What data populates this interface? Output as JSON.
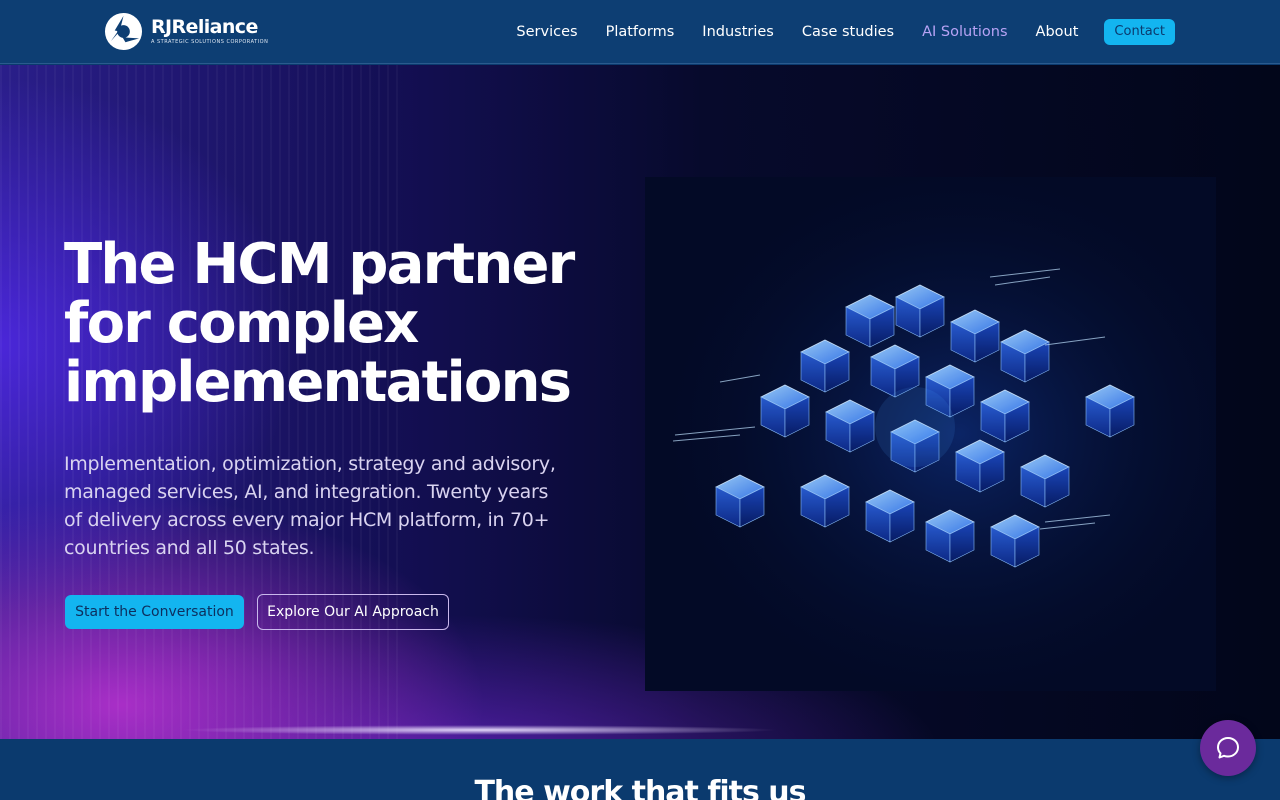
{
  "brand": {
    "name": "RJReliance",
    "tagline": "A STRATEGIC SOLUTIONS CORPORATION",
    "logo_icon": "rjreliance-logo-icon"
  },
  "nav": {
    "items": [
      {
        "label": "Services",
        "active": false
      },
      {
        "label": "Platforms",
        "active": false
      },
      {
        "label": "Industries",
        "active": false
      },
      {
        "label": "Case studies",
        "active": false
      },
      {
        "label": "AI Solutions",
        "active": true
      },
      {
        "label": "About",
        "active": false
      }
    ],
    "contact_label": "Contact"
  },
  "hero": {
    "title": "The HCM partner for complex implementations",
    "subtitle": "Implementation, optimization, strategy and advisory, managed services, AI, and integration. Twenty years of delivery across every major HCM platform, in 70+ countries and all 50 states.",
    "primary_cta": "Start the Conversation",
    "secondary_cta": "Explore Our AI Approach",
    "art_icon": "glowing-cube-cluster-illustration"
  },
  "section_two": {
    "title": "The work that fits us"
  },
  "chat": {
    "icon": "chat-bubble-icon"
  },
  "colors": {
    "header_bg": "#0d3e73",
    "accent": "#13b5f0",
    "active_nav": "#b7a3f5",
    "chat_bg": "#6b2a9c"
  }
}
